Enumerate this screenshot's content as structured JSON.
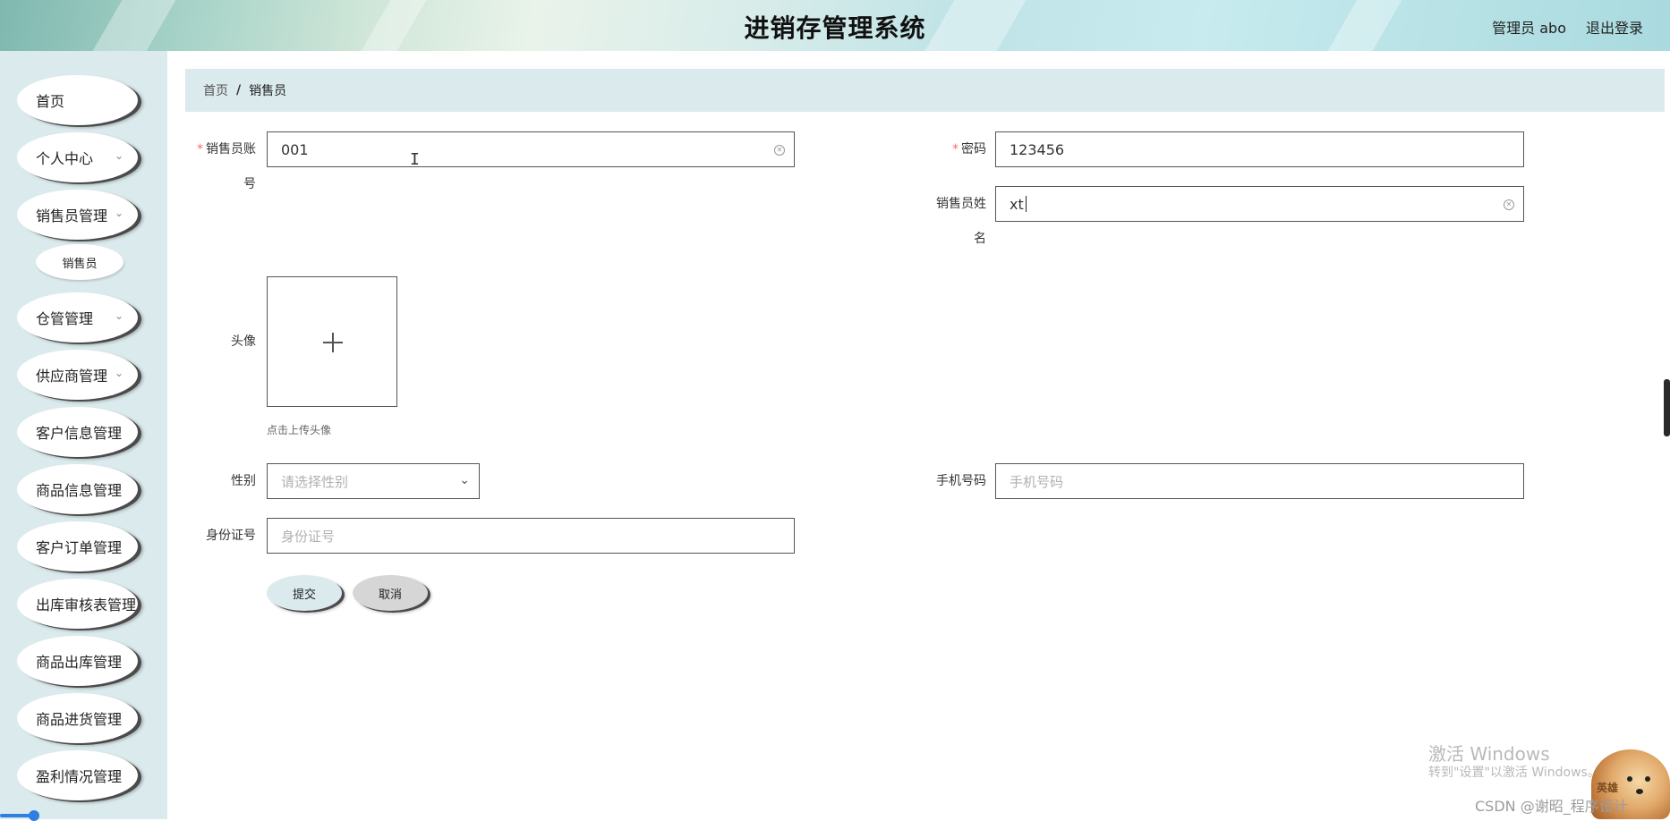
{
  "header": {
    "title": "进销存管理系统",
    "user": "管理员 abo",
    "logout": "退出登录"
  },
  "sidebar": {
    "items": [
      {
        "label": "首页",
        "has_children": false
      },
      {
        "label": "个人中心",
        "has_children": true
      },
      {
        "label": "销售员管理",
        "has_children": true
      },
      {
        "label": "仓管管理",
        "has_children": true
      },
      {
        "label": "供应商管理",
        "has_children": true
      },
      {
        "label": "客户信息管理",
        "has_children": true
      },
      {
        "label": "商品信息管理",
        "has_children": true
      },
      {
        "label": "客户订单管理",
        "has_children": true
      },
      {
        "label": "出库审核表管理",
        "has_children": true
      },
      {
        "label": "商品出库管理",
        "has_children": true
      },
      {
        "label": "商品进货管理",
        "has_children": true
      },
      {
        "label": "盈利情况管理",
        "has_children": true
      }
    ],
    "subitem": {
      "label": "销售员",
      "parent": "销售员管理"
    }
  },
  "breadcrumb": {
    "home": "首页",
    "separator": "/",
    "current": "销售员"
  },
  "form": {
    "account": {
      "label_line1": "销售员账",
      "label_line2": "号",
      "value": "001",
      "required": "*"
    },
    "password": {
      "label": "密码",
      "value": "123456",
      "required": "*"
    },
    "name": {
      "label_line1": "销售员姓",
      "label_line2": "名",
      "value": "xt"
    },
    "avatar": {
      "label": "头像",
      "tip": "点击上传头像"
    },
    "gender": {
      "label": "性别",
      "placeholder": "请选择性别"
    },
    "phone": {
      "label": "手机号码",
      "placeholder": "手机号码"
    },
    "id_card": {
      "label": "身份证号",
      "placeholder": "身份证号"
    },
    "submit": "提交",
    "cancel": "取消"
  },
  "watermark": {
    "activate_title": "激活 Windows",
    "activate_sub": "转到\"设置\"以激活 Windows。",
    "csdn": "CSDN @谢昭_程序设计",
    "sticker": "英雄"
  },
  "colors": {
    "sidebar_bg": "#dbeaed",
    "required": "#f56c6c",
    "scroll_accent": "#2f7fe0"
  }
}
